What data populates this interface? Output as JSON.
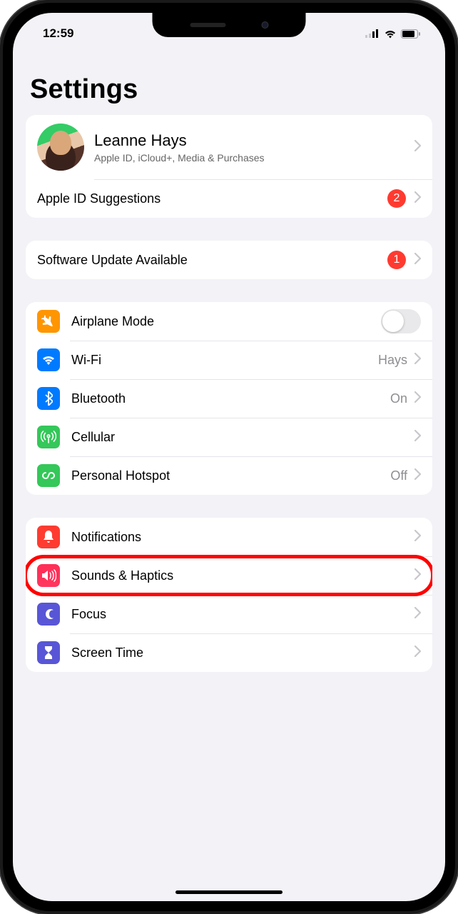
{
  "status": {
    "time": "12:59"
  },
  "page": {
    "title": "Settings"
  },
  "profile": {
    "name": "Leanne Hays",
    "subtitle": "Apple ID, iCloud+, Media & Purchases"
  },
  "suggestions": {
    "label": "Apple ID Suggestions",
    "badge": "2"
  },
  "update": {
    "label": "Software Update Available",
    "badge": "1"
  },
  "connectivity": {
    "airplane": {
      "label": "Airplane Mode",
      "on": false
    },
    "wifi": {
      "label": "Wi-Fi",
      "value": "Hays"
    },
    "bluetooth": {
      "label": "Bluetooth",
      "value": "On"
    },
    "cellular": {
      "label": "Cellular"
    },
    "hotspot": {
      "label": "Personal Hotspot",
      "value": "Off"
    }
  },
  "system": {
    "notifications": {
      "label": "Notifications"
    },
    "sounds": {
      "label": "Sounds & Haptics"
    },
    "focus": {
      "label": "Focus"
    },
    "screentime": {
      "label": "Screen Time"
    }
  },
  "annotation": {
    "highlighted_row": "sounds"
  }
}
